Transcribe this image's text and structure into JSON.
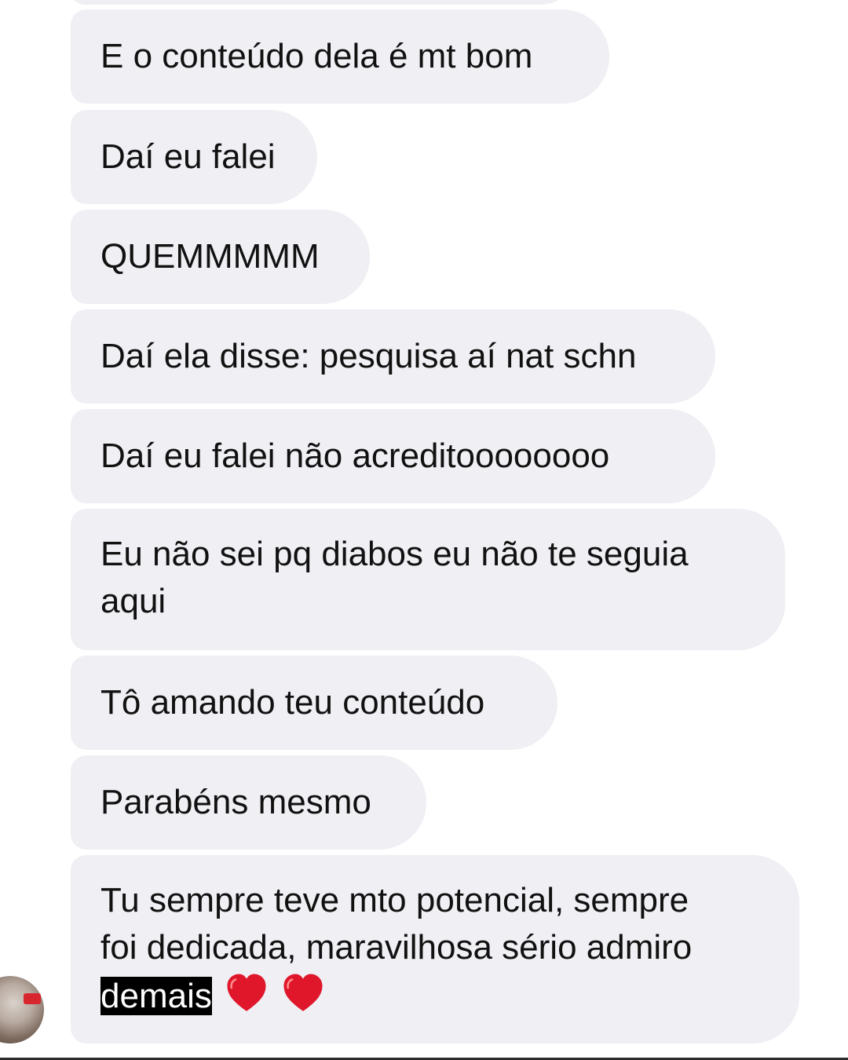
{
  "messages": [
    {
      "text": "E o conteúdo dela é mt bom"
    },
    {
      "text": "Daí eu falei"
    },
    {
      "text": "QUEMMMMM"
    },
    {
      "text": "Daí ela disse: pesquisa aí nat schn"
    },
    {
      "text": "Daí eu falei não acreditoooooooo"
    },
    {
      "line1": "Eu não sei pq diabos eu não te seguia",
      "line2": "aqui"
    },
    {
      "text": "Tô amando teu conteúdo"
    },
    {
      "text": "Parabéns mesmo"
    },
    {
      "line1": "Tu sempre teve mto potencial, sempre",
      "line2": "foi dedicada, maravilhosa sério admiro",
      "line3_highlighted": "demais",
      "emoji": [
        "red-heart",
        "red-heart"
      ]
    }
  ],
  "sender_avatar": {
    "icon": "user-avatar"
  },
  "colors": {
    "bubble": "#efeff4",
    "text": "#111111",
    "highlight_bg": "#000000",
    "highlight_text": "#ffffff",
    "heart": "#e0162b"
  }
}
